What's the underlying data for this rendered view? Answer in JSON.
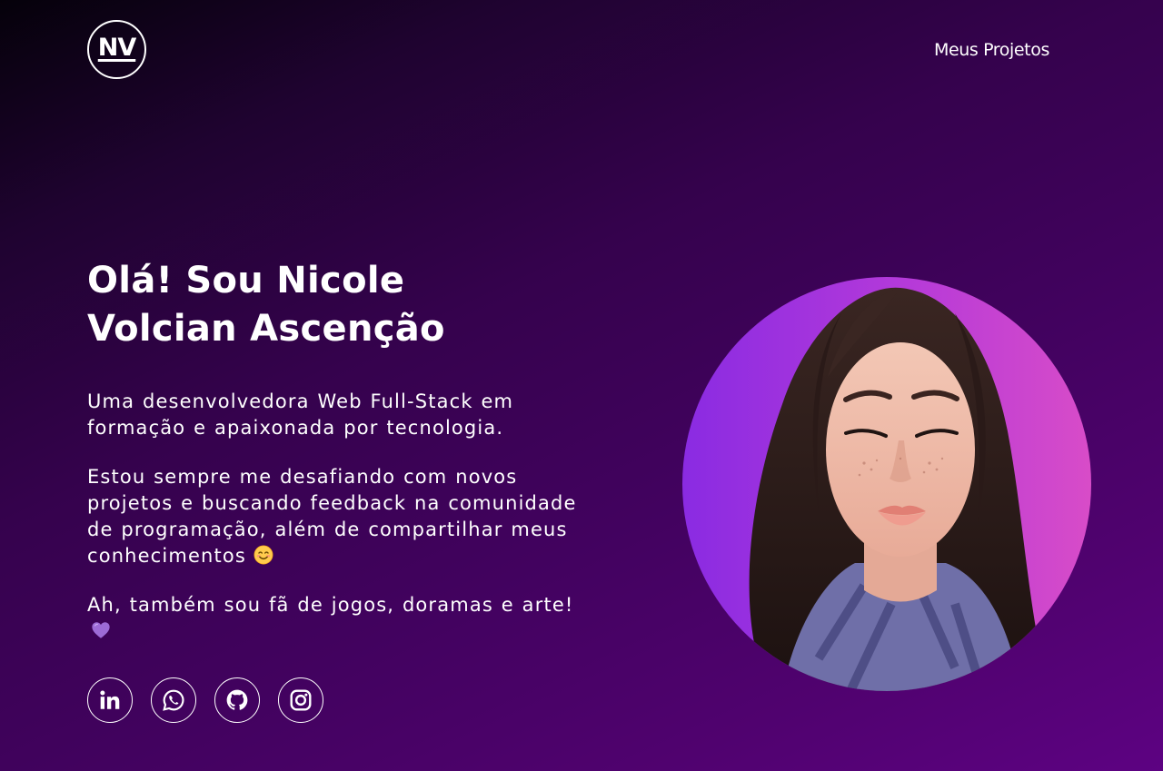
{
  "header": {
    "logo_text": "NV",
    "nav_link": "Meus Projetos"
  },
  "hero": {
    "title_line1": "Olá! Sou Nicole",
    "title_line2": "Volcian Ascenção",
    "para1": "Uma desenvolvedora Web Full-Stack em formação e apaixonada por tecnologia.",
    "para2": "Estou sempre me desafiando com novos projetos e buscando feedback na comunidade de programação, além de compartilhar meus conhecimentos",
    "para2_emoji": "smiling-face-emoji",
    "para3": "Ah, também sou fã de jogos, doramas e arte!",
    "para3_emoji": "purple-heart-emoji"
  },
  "socials": [
    {
      "icon": "linkedin-icon"
    },
    {
      "icon": "whatsapp-icon"
    },
    {
      "icon": "github-icon"
    },
    {
      "icon": "instagram-icon"
    }
  ],
  "colors": {
    "accent_gradient_start": "#8a2be2",
    "accent_gradient_end": "#d84cc8",
    "background_dark": "#05010a",
    "background_purple": "#5d0282"
  }
}
